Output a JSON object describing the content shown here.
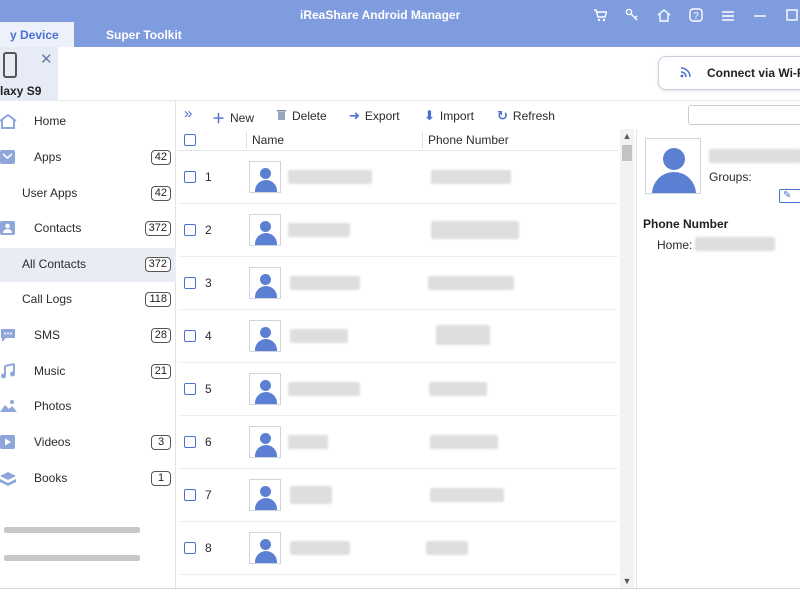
{
  "app": {
    "title": "iReaShare Android Manager",
    "tabs": [
      {
        "label": "y Device",
        "active": true
      },
      {
        "label": "Super Toolkit",
        "active": false
      }
    ],
    "window_icons": [
      "cart-icon",
      "key-icon",
      "home-icon",
      "help-icon",
      "menu-icon",
      "minimize-icon"
    ],
    "accent_color": "#7f9cde"
  },
  "device": {
    "name": "laxy S9",
    "connect_button": "Connect via Wi-F"
  },
  "sidebar": {
    "items": [
      {
        "label": "Home",
        "icon": "home-icon",
        "count": null,
        "indent": false,
        "active": false
      },
      {
        "label": "Apps",
        "icon": "apps-icon",
        "count": "42",
        "indent": false,
        "active": false
      },
      {
        "label": "User Apps",
        "icon": null,
        "count": "42",
        "indent": true,
        "active": false
      },
      {
        "label": "Contacts",
        "icon": "contacts-icon",
        "count": "372",
        "indent": false,
        "active": false
      },
      {
        "label": "All Contacts",
        "icon": null,
        "count": "372",
        "indent": true,
        "active": true
      },
      {
        "label": "Call Logs",
        "icon": null,
        "count": "118",
        "indent": true,
        "active": false
      },
      {
        "label": "SMS",
        "icon": "sms-icon",
        "count": "28",
        "indent": false,
        "active": false
      },
      {
        "label": "Music",
        "icon": "music-icon",
        "count": "21",
        "indent": false,
        "active": false
      },
      {
        "label": "Photos",
        "icon": "photos-icon",
        "count": null,
        "indent": false,
        "active": false
      },
      {
        "label": "Videos",
        "icon": "videos-icon",
        "count": "3",
        "indent": false,
        "active": false
      },
      {
        "label": "Books",
        "icon": "books-icon",
        "count": "1",
        "indent": false,
        "active": false
      }
    ]
  },
  "toolbar": {
    "new": "New",
    "delete": "Delete",
    "export": "Export",
    "import": "Import",
    "refresh": "Refresh"
  },
  "table": {
    "headers": {
      "name": "Name",
      "phone": "Phone Number"
    },
    "rows": [
      "1",
      "2",
      "3",
      "4",
      "5",
      "6",
      "7",
      "8"
    ]
  },
  "details": {
    "groups_label": "Groups:",
    "phone_heading": "Phone Number",
    "home_label": "Home:"
  }
}
